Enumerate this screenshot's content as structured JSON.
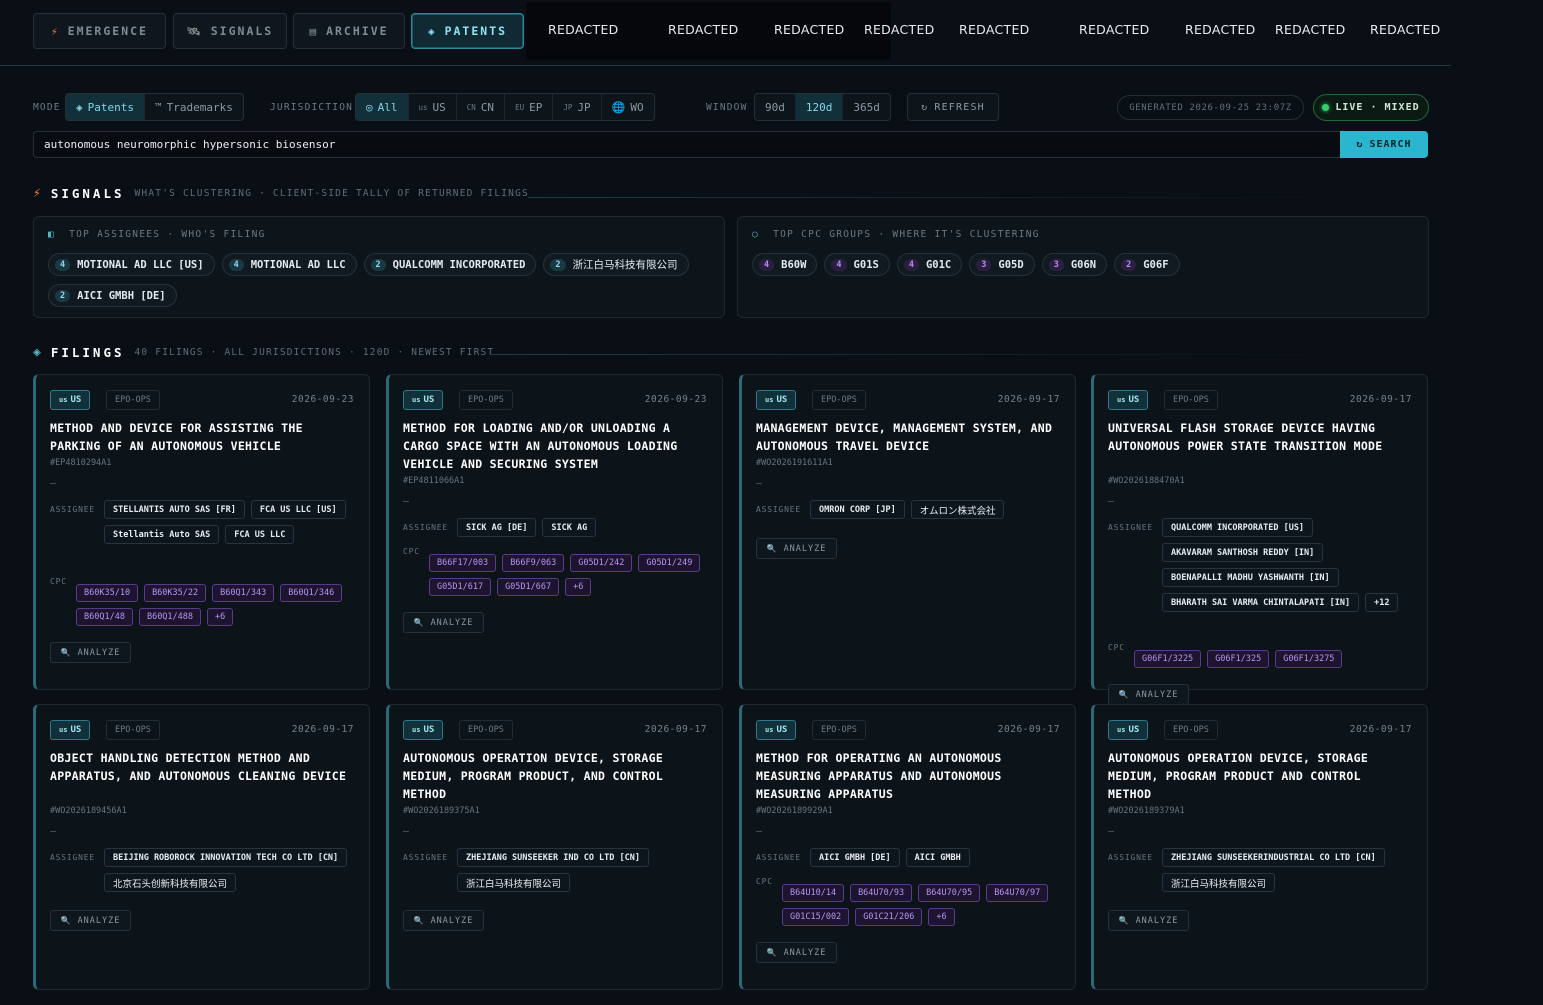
{
  "nav": {
    "tabs": [
      {
        "label": "EMERGENCE",
        "icon": "bolt-icon",
        "glyph": "⚡"
      },
      {
        "label": "SIGNALS",
        "icon": "satellite-icon",
        "glyph": "🛰"
      },
      {
        "label": "ARCHIVE",
        "icon": "archive-icon",
        "glyph": "▤"
      },
      {
        "label": "PATENTS",
        "icon": "diamond-icon",
        "glyph": "◈"
      }
    ],
    "redacted": [
      "REDACTED",
      "REDACTED",
      "REDACTED",
      "REDACTED",
      "REDACTED",
      "REDACTED",
      "REDACTED",
      "REDACTED",
      "REDACTED"
    ]
  },
  "filters": {
    "mode_label": "MODE",
    "mode_options": [
      {
        "label": "Patents",
        "glyph": "◈"
      },
      {
        "label": "Trademarks",
        "glyph": "™"
      }
    ],
    "jurisdiction_label": "JURISDICTION",
    "jurisdiction_options": [
      {
        "code": "",
        "label": "All",
        "glyph": "◎"
      },
      {
        "code": "us",
        "label": "US"
      },
      {
        "code": "CN",
        "label": "CN"
      },
      {
        "code": "EU",
        "label": "EP"
      },
      {
        "code": "JP",
        "label": "JP"
      },
      {
        "code": "",
        "label": "WO",
        "glyph": "🌐"
      }
    ],
    "window_label": "WINDOW",
    "window_options": [
      "90d",
      "120d",
      "365d"
    ],
    "refresh_label": "REFRESH",
    "generated": "GENERATED 2026-09-25 23:07Z",
    "live": "LIVE · MIXED"
  },
  "search": {
    "value": "autonomous neuromorphic hypersonic biosensor",
    "button": "SEARCH"
  },
  "signals": {
    "title": "SIGNALS",
    "subtitle": "WHAT'S CLUSTERING · CLIENT-SIDE TALLY OF RETURNED FILINGS",
    "assignees_title": "TOP ASSIGNEES · WHO'S FILING",
    "assignees": [
      {
        "count": "4",
        "name": "MOTIONAL AD LLC [US]"
      },
      {
        "count": "4",
        "name": "MOTIONAL AD LLC"
      },
      {
        "count": "2",
        "name": "QUALCOMM INCORPORATED"
      },
      {
        "count": "2",
        "name": "浙江白马科技有限公司"
      },
      {
        "count": "2",
        "name": "AICI GMBH [DE]"
      }
    ],
    "cpc_title": "TOP CPC GROUPS · WHERE IT'S CLUSTERING",
    "cpc": [
      {
        "count": "4",
        "name": "B60W"
      },
      {
        "count": "4",
        "name": "G01S"
      },
      {
        "count": "4",
        "name": "G01C"
      },
      {
        "count": "3",
        "name": "G05D"
      },
      {
        "count": "3",
        "name": "G06N"
      },
      {
        "count": "2",
        "name": "G06F"
      }
    ]
  },
  "filings": {
    "title": "FILINGS",
    "subtitle": "40 FILINGS · ALL JURISDICTIONS · 120D · NEWEST FIRST",
    "labels": {
      "assignee": "ASSIGNEE",
      "cpc": "CPC",
      "analyze": "ANALYZE",
      "dash": "—",
      "country": "US",
      "country_small": "us"
    },
    "cards": [
      {
        "source": "EPO-OPS",
        "date": "2026-09-23",
        "title": "METHOD AND DEVICE FOR ASSISTING THE PARKING OF AN AUTONOMOUS VEHICLE",
        "pub": "#EP4810294A1",
        "assignees": [
          "STELLANTIS AUTO SAS [FR]",
          "FCA US LLC [US]",
          "Stellantis Auto SAS",
          "FCA US LLC"
        ],
        "cpc": [
          "B60K35/10",
          "B60K35/22",
          "B60Q1/343",
          "B60Q1/346",
          "B60Q1/48",
          "B60Q1/488",
          "+6"
        ]
      },
      {
        "source": "EPO-OPS",
        "date": "2026-09-23",
        "title": "METHOD FOR LOADING AND/OR UNLOADING A CARGO SPACE WITH AN AUTONOMOUS LOADING VEHICLE AND SECURING SYSTEM",
        "pub": "#EP4811066A1",
        "assignees": [
          "SICK AG [DE]",
          "SICK AG"
        ],
        "cpc": [
          "B66F17/003",
          "B66F9/063",
          "G05D1/242",
          "G05D1/249",
          "G05D1/617",
          "G05D1/667",
          "+6"
        ]
      },
      {
        "source": "EPO-OPS",
        "date": "2026-09-17",
        "title": "MANAGEMENT DEVICE, MANAGEMENT SYSTEM, AND AUTONOMOUS TRAVEL DEVICE",
        "pub": "#WO2026191611A1",
        "assignees": [
          "OMRON CORP [JP]",
          "オムロン株式会社"
        ],
        "cpc": []
      },
      {
        "source": "EPO-OPS",
        "date": "2026-09-17",
        "title": "UNIVERSAL FLASH STORAGE DEVICE HAVING AUTONOMOUS POWER STATE TRANSITION MODE",
        "pub": "#WO2026188470A1",
        "assignees": [
          "QUALCOMM INCORPORATED [US]",
          "AKAVARAM SANTHOSH REDDY [IN]",
          "BOENAPALLI MADHU YASHWANTH [IN]",
          "BHARATH SAI VARMA CHINTALAPATI [IN]",
          "+12"
        ],
        "cpc": [
          "G06F1/3225",
          "G06F1/325",
          "G06F1/3275"
        ]
      },
      {
        "source": "EPO-OPS",
        "date": "2026-09-17",
        "title": "OBJECT HANDLING DETECTION METHOD AND APPARATUS, AND AUTONOMOUS CLEANING DEVICE",
        "pub": "#WO2026189456A1",
        "assignees": [
          "BEIJING ROBOROCK INNOVATION TECH CO LTD [CN]",
          "北京石头创新科技有限公司"
        ],
        "cpc": []
      },
      {
        "source": "EPO-OPS",
        "date": "2026-09-17",
        "title": "AUTONOMOUS OPERATION DEVICE, STORAGE MEDIUM, PROGRAM PRODUCT, AND CONTROL METHOD",
        "pub": "#WO2026189375A1",
        "assignees": [
          "ZHEJIANG SUNSEEKER IND CO LTD [CN]",
          "浙江白马科技有限公司"
        ],
        "cpc": []
      },
      {
        "source": "EPO-OPS",
        "date": "2026-09-17",
        "title": "METHOD FOR OPERATING AN AUTONOMOUS MEASURING APPARATUS AND AUTONOMOUS MEASURING APPARATUS",
        "pub": "#WO2026189929A1",
        "assignees": [
          "AICI GMBH [DE]",
          "AICI GMBH"
        ],
        "cpc": [
          "B64U10/14",
          "B64U70/93",
          "B64U70/95",
          "B64U70/97",
          "G01C15/002",
          "G01C21/206",
          "+6"
        ]
      },
      {
        "source": "EPO-OPS",
        "date": "2026-09-17",
        "title": "AUTONOMOUS OPERATION DEVICE, STORAGE MEDIUM, PROGRAM PRODUCT AND CONTROL METHOD",
        "pub": "#WO2026189379A1",
        "assignees": [
          "ZHEJIANG SUNSEEKERINDUSTRIAL CO LTD [CN]",
          "浙江白马科技有限公司"
        ],
        "cpc": []
      }
    ]
  }
}
